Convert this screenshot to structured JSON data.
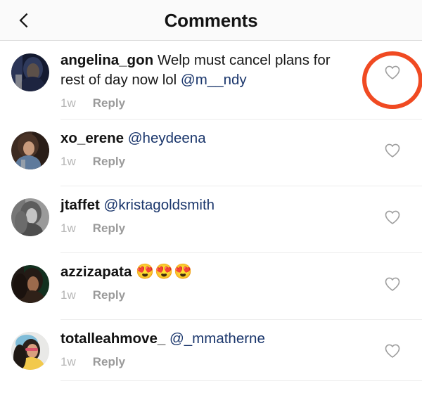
{
  "header": {
    "title": "Comments",
    "back_icon": "chevron-left-icon"
  },
  "comments": [
    {
      "username": "angelina_gon",
      "text": " Welp must cancel plans for rest of day now lol ",
      "mention": "@m__ndy",
      "emoji": "",
      "time": "1w",
      "reply_label": "Reply",
      "like_icon": "heart-outline-icon",
      "annotated": true,
      "avatar_colors": [
        "#1b2340",
        "#2d3a5e",
        "#6d5a54"
      ]
    },
    {
      "username": "xo_erene",
      "text": " ",
      "mention": "@heydeena",
      "emoji": "",
      "time": "1w",
      "reply_label": "Reply",
      "like_icon": "heart-outline-icon",
      "annotated": false,
      "avatar_colors": [
        "#6a4a3c",
        "#9c7b64",
        "#3a2b24"
      ]
    },
    {
      "username": "jtaffet",
      "text": " ",
      "mention": "@kristagoldsmith",
      "emoji": "",
      "time": "1w",
      "reply_label": "Reply",
      "like_icon": "heart-outline-icon",
      "annotated": false,
      "avatar_colors": [
        "#8c8c8c",
        "#b8b8b8",
        "#5a5a5a"
      ]
    },
    {
      "username": "azzizapata",
      "text": " ",
      "mention": "",
      "emoji": "😍😍😍",
      "time": "1w",
      "reply_label": "Reply",
      "like_icon": "heart-outline-icon",
      "annotated": false,
      "avatar_colors": [
        "#0e2f22",
        "#8b5a45",
        "#241a16"
      ]
    },
    {
      "username": "totalleahmove_",
      "text": " ",
      "mention": "@_mmatherne",
      "emoji": "",
      "time": "1w",
      "reply_label": "Reply",
      "like_icon": "heart-outline-icon",
      "annotated": false,
      "avatar_colors": [
        "#f2c84b",
        "#6fb6d8",
        "#2b2320"
      ]
    }
  ],
  "colors": {
    "annotation": "#f04a22",
    "mention_link": "#19356b",
    "heart_outline": "#9e9e9e",
    "header_bg": "#fafafa",
    "separator": "#ededed"
  }
}
